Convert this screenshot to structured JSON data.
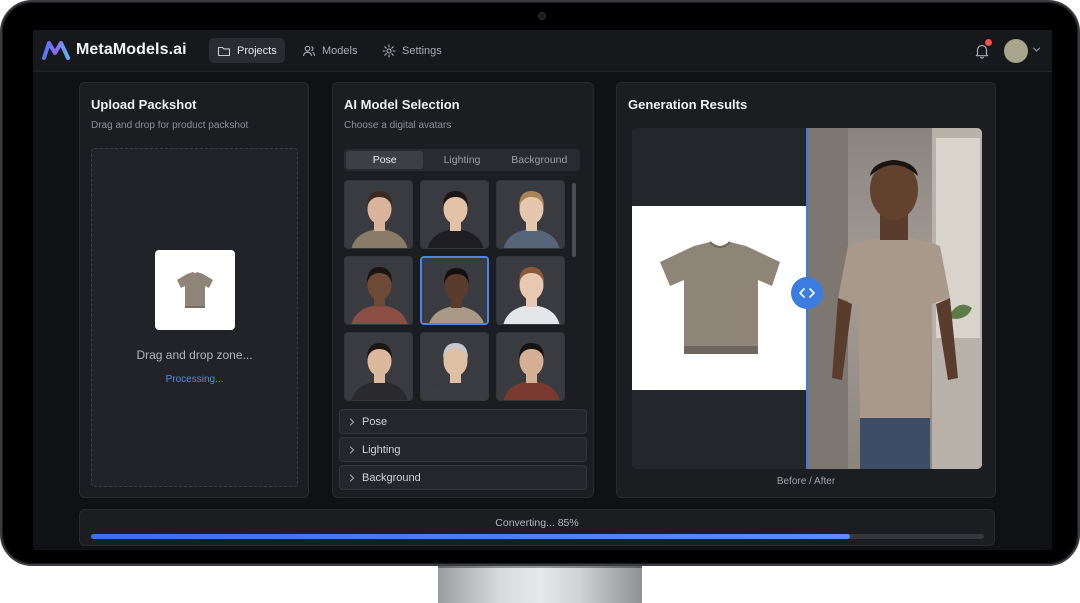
{
  "app": {
    "name": "MetaModels.ai",
    "accent": "#4a86e8"
  },
  "nav": {
    "items": [
      {
        "label": "Projects",
        "icon": "folder-icon",
        "active": true
      },
      {
        "label": "Models",
        "icon": "users-icon",
        "active": false
      },
      {
        "label": "Settings",
        "icon": "gear-icon",
        "active": false
      }
    ],
    "notifications_icon": "bell-icon",
    "user_menu_icon": "chevron-down-icon"
  },
  "upload": {
    "title": "Upload Packshot",
    "subtitle": "Drag and drop for product packshot",
    "drop_label": "Drag and drop zone...",
    "status": "Processing..."
  },
  "models": {
    "title": "AI Model Selection",
    "subtitle": "Choose a digital avatars",
    "tabs": [
      {
        "label": "Pose",
        "active": true
      },
      {
        "label": "Lighting",
        "active": false
      },
      {
        "label": "Background",
        "active": false
      }
    ],
    "avatars": [
      {
        "skin": "#d9b49a",
        "hair": "#3a2a22",
        "cloth": "#8a7a68",
        "selected": false
      },
      {
        "skin": "#e3c2a8",
        "hair": "#1c1614",
        "cloth": "#1e1e22",
        "selected": false
      },
      {
        "skin": "#e6c6ac",
        "hair": "#a88458",
        "cloth": "#56657a",
        "selected": false
      },
      {
        "skin": "#6e4a36",
        "hair": "#1a1412",
        "cloth": "#8a4e44",
        "selected": false
      },
      {
        "skin": "#5a3c2c",
        "hair": "#141010",
        "cloth": "#a89a86",
        "selected": true
      },
      {
        "skin": "#e8c8b0",
        "hair": "#8a5a3a",
        "cloth": "#e4e6ea",
        "selected": false
      },
      {
        "skin": "#dcb89c",
        "hair": "#1c1614",
        "cloth": "#2a2a2e",
        "selected": false
      },
      {
        "skin": "#e0c0a4",
        "hair": "#c8c8cc",
        "cloth": "#3a3c44",
        "selected": false
      },
      {
        "skin": "#d6b094",
        "hair": "#161212",
        "cloth": "#7a3a30",
        "selected": false
      }
    ],
    "accordions": [
      "Pose",
      "Lighting",
      "Background"
    ]
  },
  "results": {
    "title": "Generation Results",
    "caption": "Before / After",
    "product_color": "#8f8478"
  },
  "progress": {
    "label": "Converting... 85%",
    "value": 85
  }
}
